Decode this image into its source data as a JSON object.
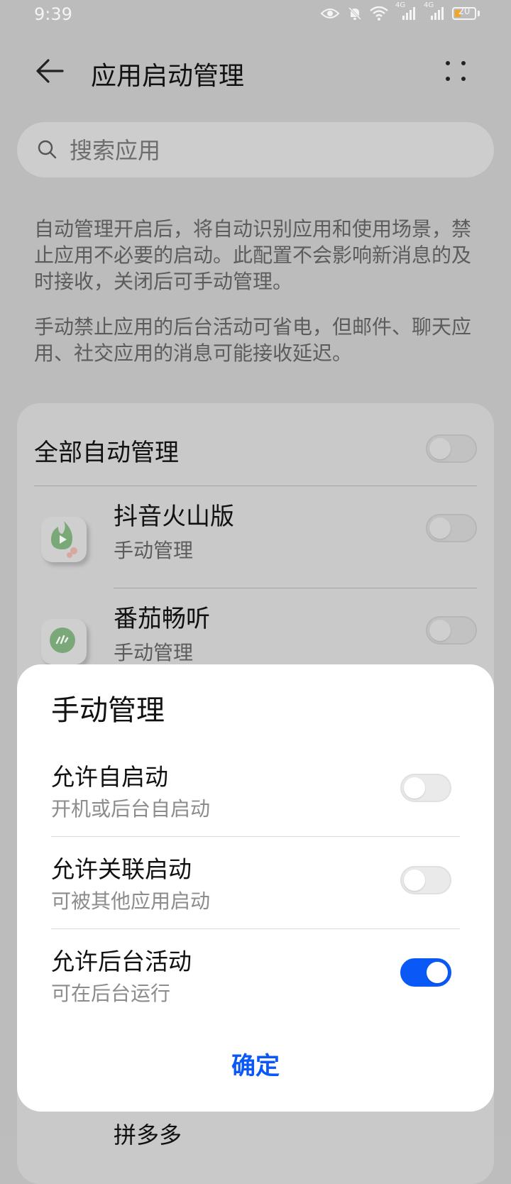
{
  "status_bar": {
    "time": "9:39",
    "network_label_1": "4G",
    "network_label_2": "4G",
    "battery": "20",
    "battery_color": "#f0a428"
  },
  "header": {
    "title": "应用启动管理",
    "back_icon": "arrow-left-icon",
    "more_icon": "four-dots-icon"
  },
  "search": {
    "placeholder": "搜索应用",
    "value": ""
  },
  "description": {
    "p1": "自动管理开启后，将自动识别应用和使用场景，禁止应用不必要的启动。此配置不会影响新消息的及时接收，关闭后可手动管理。",
    "p2": "手动禁止应用的后台活动可省电，但邮件、聊天应用、社交应用的消息可能接收延迟。"
  },
  "card": {
    "all_label": "全部自动管理",
    "all_enabled": false,
    "apps": [
      {
        "name": "抖音火山版",
        "status": "手动管理",
        "icon": "douyin-huoshan-icon",
        "enabled": false
      },
      {
        "name": "番茄畅听",
        "status": "手动管理",
        "icon": "fanqie-changting-icon",
        "enabled": false
      }
    ],
    "peek_name": "拼多多"
  },
  "dialog": {
    "title": "手动管理",
    "options": [
      {
        "title": "允许自启动",
        "subtitle": "开机或后台自启动",
        "enabled": false
      },
      {
        "title": "允许关联启动",
        "subtitle": "可被其他应用启动",
        "enabled": false
      },
      {
        "title": "允许后台活动",
        "subtitle": "可在后台运行",
        "enabled": true
      }
    ],
    "confirm_label": "确定",
    "accent_color": "#0a59f7"
  }
}
